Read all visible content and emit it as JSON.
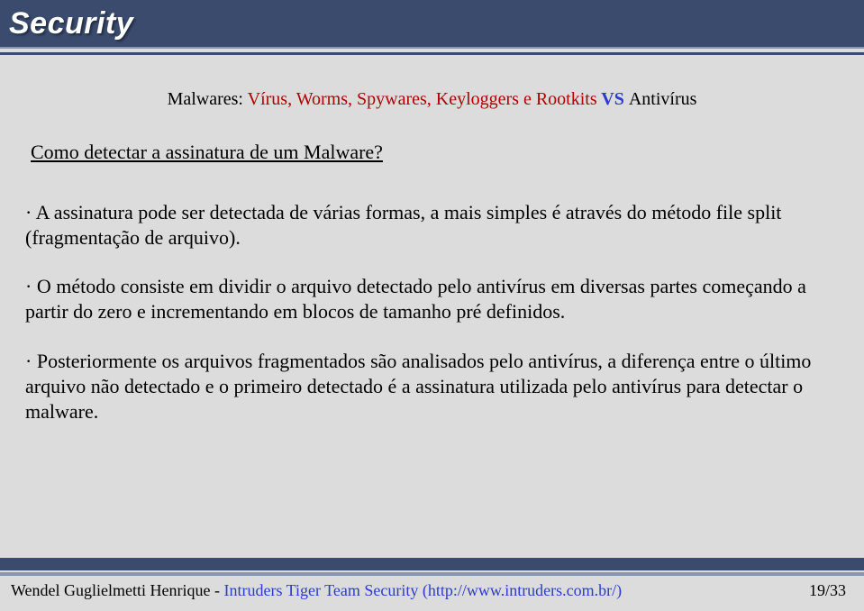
{
  "header": {
    "logo": "Security"
  },
  "slide": {
    "title": {
      "prefix": "Malwares: ",
      "redpart": "Vírus, Worms, Spywares, Keyloggers e Rootkits",
      "vs": " VS ",
      "suffix": "Antivírus"
    },
    "subtitle": "Como detectar a assinatura de um Malware?",
    "bullets": [
      "A assinatura pode ser detectada de várias formas, a mais simples é através do método file split (fragmentação de arquivo).",
      "O método consiste em dividir o arquivo detectado pelo antivírus em diversas partes começando a partir do zero e incrementando em blocos de tamanho pré definidos.",
      "Posteriormente os arquivos fragmentados são analisados pelo antivírus, a diferença entre o último arquivo não detectado e o primeiro detectado é a assinatura utilizada pelo antivírus para detectar o malware."
    ]
  },
  "footer": {
    "author": "Wendel Guglielmetti Henrique",
    "sep": "  -  ",
    "org": "Intruders Tiger Team Security  (http://www.intruders.com.br/)",
    "page": "19/33"
  }
}
